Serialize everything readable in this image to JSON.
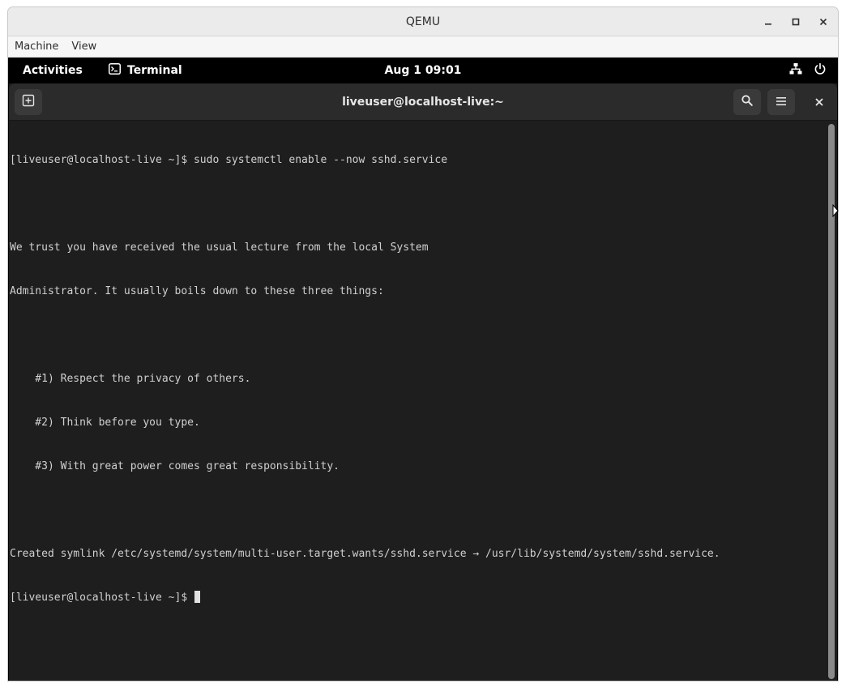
{
  "qemu": {
    "title": "QEMU",
    "menu": [
      "Machine",
      "View"
    ]
  },
  "topbar": {
    "activities": "Activities",
    "app_name": "Terminal",
    "clock": "Aug 1  09:01",
    "icons": [
      "network-wired-icon",
      "power-icon"
    ]
  },
  "terminal": {
    "title": "liveuser@localhost-live:~",
    "lines": [
      "[liveuser@localhost-live ~]$ sudo systemctl enable --now sshd.service",
      "",
      "We trust you have received the usual lecture from the local System",
      "Administrator. It usually boils down to these three things:",
      "",
      "    #1) Respect the privacy of others.",
      "    #2) Think before you type.",
      "    #3) With great power comes great responsibility.",
      "",
      "Created symlink /etc/systemd/system/multi-user.target.wants/sshd.service → /usr/lib/systemd/system/sshd.service.",
      "[liveuser@localhost-live ~]$ "
    ]
  },
  "colors": {
    "terminal_bg": "#1e1e1e",
    "header_bg": "#2b2b2b",
    "text": "#d0d0d0",
    "topbar_bg": "#000000"
  }
}
